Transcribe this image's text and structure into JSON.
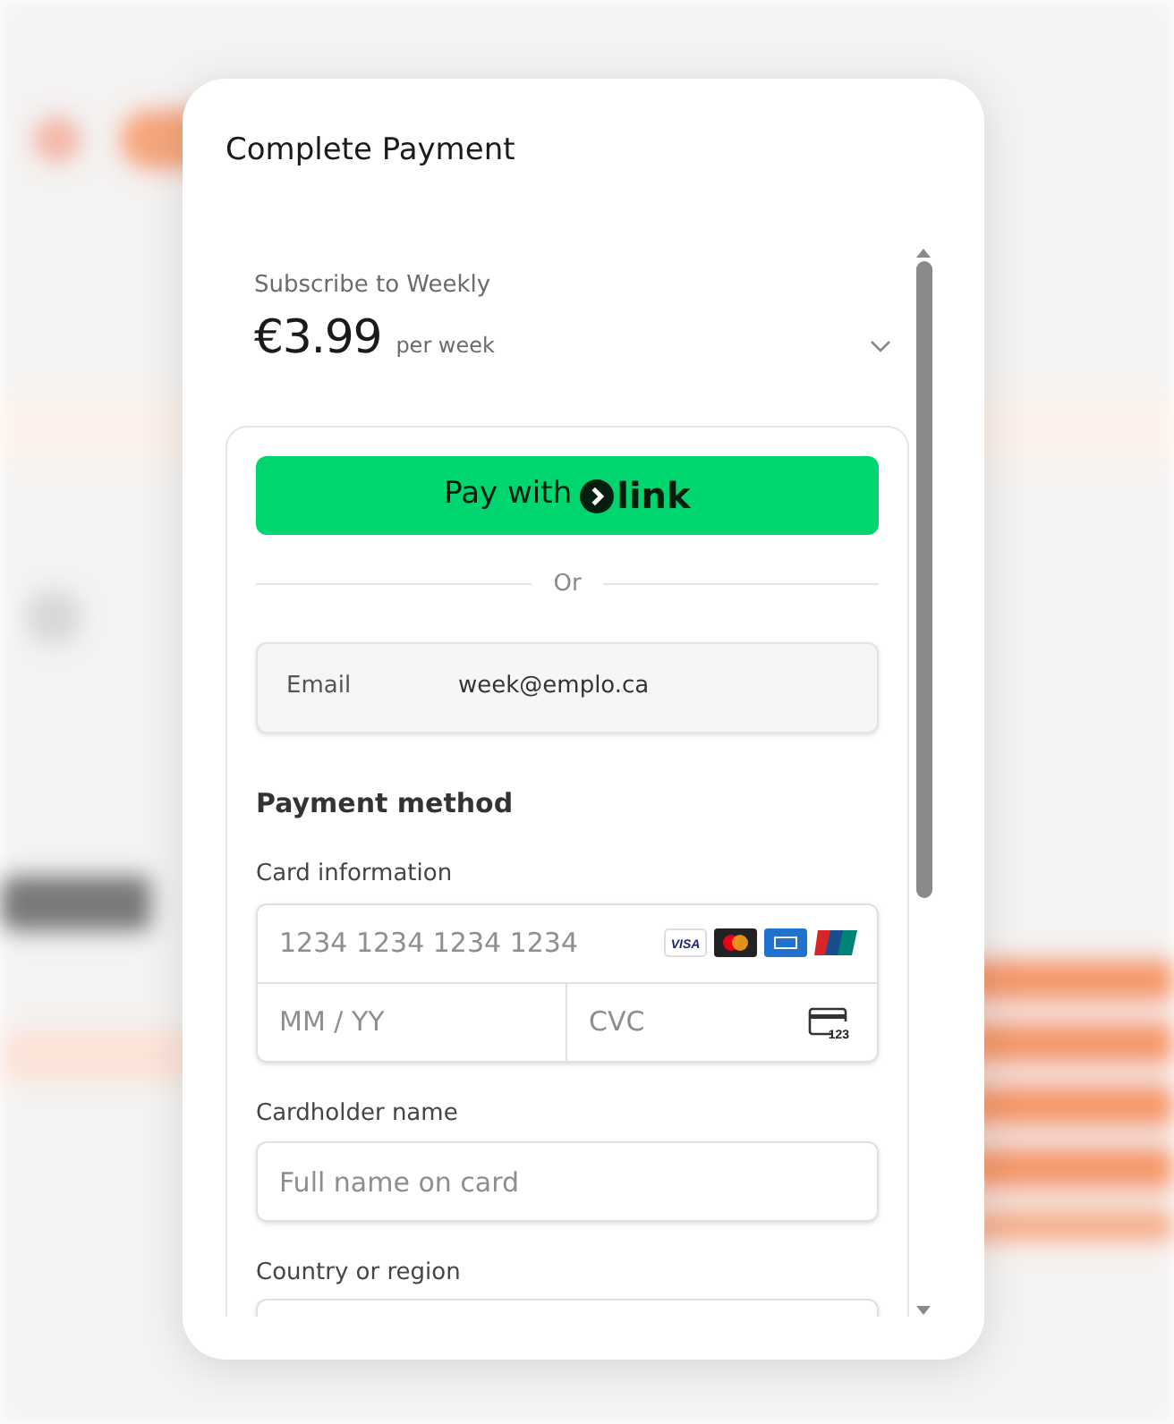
{
  "dialog": {
    "title": "Complete Payment"
  },
  "plan": {
    "name": "Subscribe to Weekly",
    "price": "€3.99",
    "period": "per week",
    "expanded": false
  },
  "link_button": {
    "label": "Pay with",
    "brand": "link"
  },
  "divider": "Or",
  "email": {
    "label": "Email",
    "value": "week@emplo.ca"
  },
  "payment_method": {
    "heading": "Payment method",
    "card_label": "Card information",
    "card_number": {
      "placeholder": "1234 1234 1234 1234"
    },
    "card_brands": [
      {
        "kind": "visa",
        "label": "VISA"
      },
      {
        "kind": "mastercard"
      },
      {
        "kind": "amex"
      },
      {
        "kind": "unionpay"
      }
    ],
    "expiry": {
      "placeholder": "MM / YY"
    },
    "cvc": {
      "placeholder": "CVC",
      "icon_text": "123"
    },
    "name_label": "Cardholder name",
    "name": {
      "placeholder": "Full name on card"
    },
    "country_label": "Country or region"
  }
}
